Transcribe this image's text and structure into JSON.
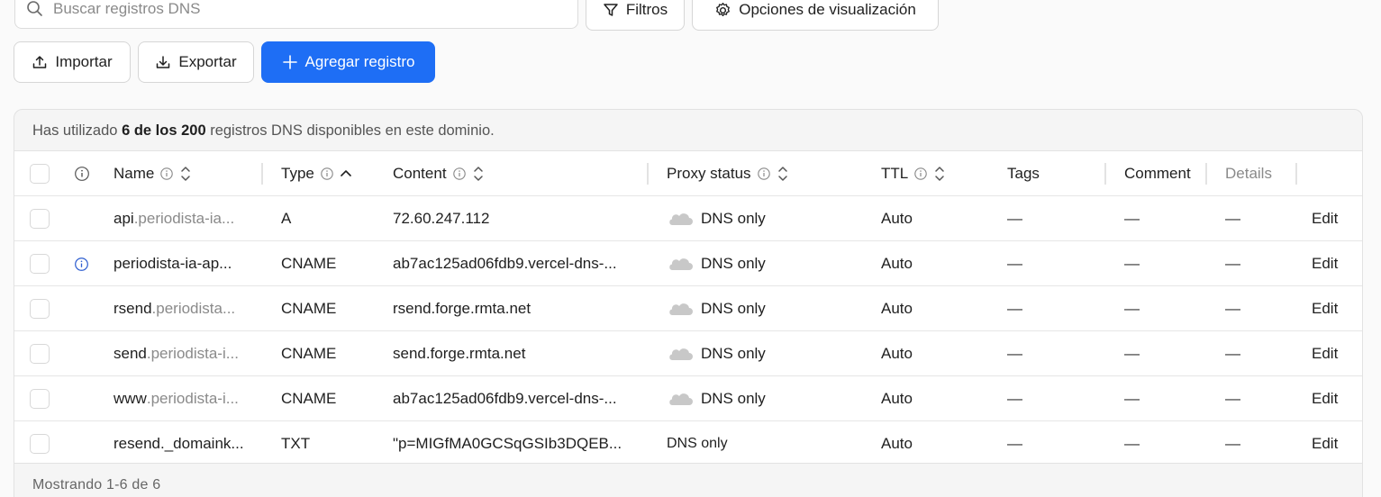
{
  "search": {
    "placeholder": "Buscar registros DNS"
  },
  "toolbar": {
    "filters_label": "Filtros",
    "view_options_label": "Opciones de visualización",
    "import_label": "Importar",
    "export_label": "Exportar",
    "add_record_label": "Agregar registro"
  },
  "usage": {
    "prefix": "Has utilizado ",
    "count": "6 de los 200",
    "suffix": " registros DNS disponibles en este dominio."
  },
  "table": {
    "headers": {
      "name": "Name",
      "type": "Type",
      "content": "Content",
      "proxy": "Proxy status",
      "ttl": "TTL",
      "tags": "Tags",
      "comment": "Comment",
      "details": "Details"
    },
    "rows": [
      {
        "name_main": "api",
        "name_rest": ".periodista-ia...",
        "type": "A",
        "content": "72.60.247.112",
        "proxy": "DNS only",
        "ttl": "Auto",
        "tags": "—",
        "comment": "—",
        "details": "—",
        "action": "Edit"
      },
      {
        "name_main": "periodista-ia-ap...",
        "name_rest": "",
        "type": "CNAME",
        "content": "ab7ac125ad06fdb9.vercel-dns-...",
        "proxy": "DNS only",
        "ttl": "Auto",
        "tags": "—",
        "comment": "—",
        "details": "—",
        "action": "Edit"
      },
      {
        "name_main": "rsend",
        "name_rest": ".periodista...",
        "type": "CNAME",
        "content": "rsend.forge.rmta.net",
        "proxy": "DNS only",
        "ttl": "Auto",
        "tags": "—",
        "comment": "—",
        "details": "—",
        "action": "Edit"
      },
      {
        "name_main": "send",
        "name_rest": ".periodista-i...",
        "type": "CNAME",
        "content": "send.forge.rmta.net",
        "proxy": "DNS only",
        "ttl": "Auto",
        "tags": "—",
        "comment": "—",
        "details": "—",
        "action": "Edit"
      },
      {
        "name_main": "www",
        "name_rest": ".periodista-i...",
        "type": "CNAME",
        "content": "ab7ac125ad06fdb9.vercel-dns-...",
        "proxy": "DNS only",
        "ttl": "Auto",
        "tags": "—",
        "comment": "—",
        "details": "—",
        "action": "Edit"
      },
      {
        "name_main": "resend._domaink...",
        "name_rest": "",
        "type": "TXT",
        "content": "\"p=MIGfMA0GCSqGSIb3DQEB...",
        "proxy": "DNS only",
        "ttl": "Auto",
        "tags": "—",
        "comment": "—",
        "details": "—",
        "action": "Edit"
      }
    ]
  },
  "footer": {
    "showing": "Mostrando 1-6 de 6"
  },
  "colors": {
    "primary": "#1e6ef5",
    "info_icon": "#2f5fd0",
    "cloud": "#c8c8c8"
  },
  "icons": [
    "search-icon",
    "filter-icon",
    "gear-icon",
    "upload-icon",
    "download-icon",
    "plus-icon",
    "info-icon",
    "sort-icon",
    "cloud-icon"
  ]
}
